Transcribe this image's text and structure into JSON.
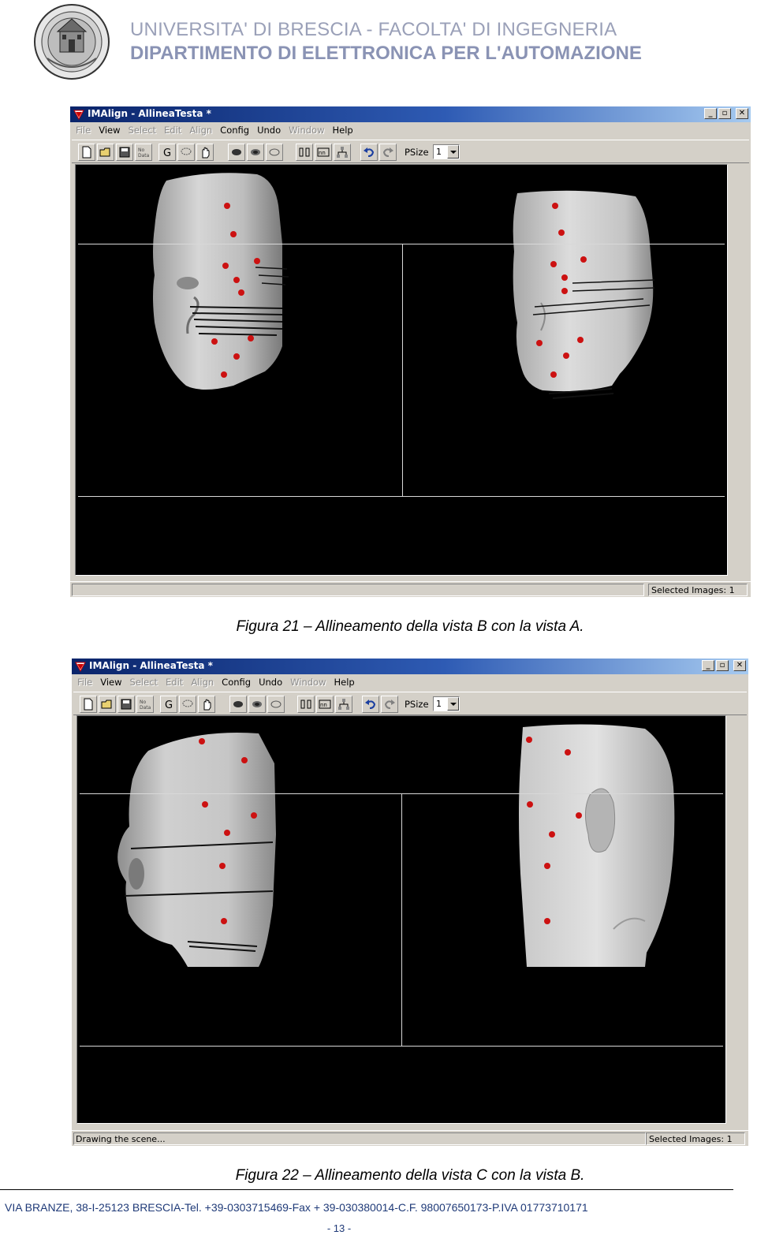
{
  "header": {
    "line1": "UNIVERSITA' DI BRESCIA - FACOLTA' DI INGEGNERIA",
    "line2": "DIPARTIMENTO DI ELETTRONICA PER L'AUTOMAZIONE"
  },
  "app": {
    "title": "IMAlign - AllineaTesta *",
    "menu": [
      {
        "label": "File",
        "enabled": false
      },
      {
        "label": "View",
        "enabled": true
      },
      {
        "label": "Select",
        "enabled": false
      },
      {
        "label": "Edit",
        "enabled": false
      },
      {
        "label": "Align",
        "enabled": false
      },
      {
        "label": "Config",
        "enabled": true
      },
      {
        "label": "Undo",
        "enabled": true
      },
      {
        "label": "Window",
        "enabled": false
      },
      {
        "label": "Help",
        "enabled": true
      }
    ],
    "psize_label": "PSize",
    "psize_value": "1"
  },
  "figures": [
    {
      "caption": "Figura 21 – Allineamento della vista B con la vista A.",
      "status_left": "",
      "status_right": "Selected Images: 1"
    },
    {
      "caption": "Figura 22 – Allineamento della vista C con la vista B.",
      "status_left": "Drawing the scene...",
      "status_right": "Selected Images: 1"
    }
  ],
  "footer": {
    "address": "VIA BRANZE, 38-I-25123 BRESCIA-Tel. +39-0303715469-Fax + 39-030380014-C.F. 98007650173-P.IVA 01773710171",
    "page": "- 13 -"
  },
  "colors": {
    "titlebar_start": "#0a246a",
    "window_face": "#d4d0c8",
    "viewport": "#000000",
    "marker": "#cc1111",
    "header_text": "#9aa0b8"
  }
}
